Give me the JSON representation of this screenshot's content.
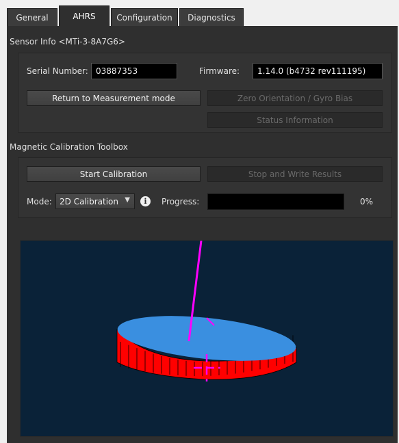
{
  "tabs": [
    {
      "label": "General"
    },
    {
      "label": "AHRS"
    },
    {
      "label": "Configuration"
    },
    {
      "label": "Diagnostics"
    }
  ],
  "active_tab": "AHRS",
  "sensor_info": {
    "title": "Sensor Info <MTi-3-8A7G6>",
    "serial_label": "Serial Number:",
    "serial_value": "03887353",
    "firmware_label": "Firmware:",
    "firmware_value": "1.14.0 (b4732 rev111195)",
    "return_button": "Return to Measurement mode",
    "zero_button": "Zero Orientation / Gyro Bias",
    "status_button": "Status Information"
  },
  "mag_cal": {
    "title": "Magnetic Calibration Toolbox",
    "start_button": "Start Calibration",
    "stop_button": "Stop and Write Results",
    "mode_label": "Mode:",
    "mode_value": "2D Calibration",
    "progress_label": "Progress:",
    "progress_text": "0%",
    "progress_fraction": 0
  },
  "colors": {
    "disc_top": "#3a8fe0",
    "disc_side": "#ff0000",
    "axis": "#ff00ff",
    "view_background": "#0a2238"
  },
  "icons": {
    "mode_dropdown": "chevron-down-icon",
    "mode_info": "info-icon"
  }
}
